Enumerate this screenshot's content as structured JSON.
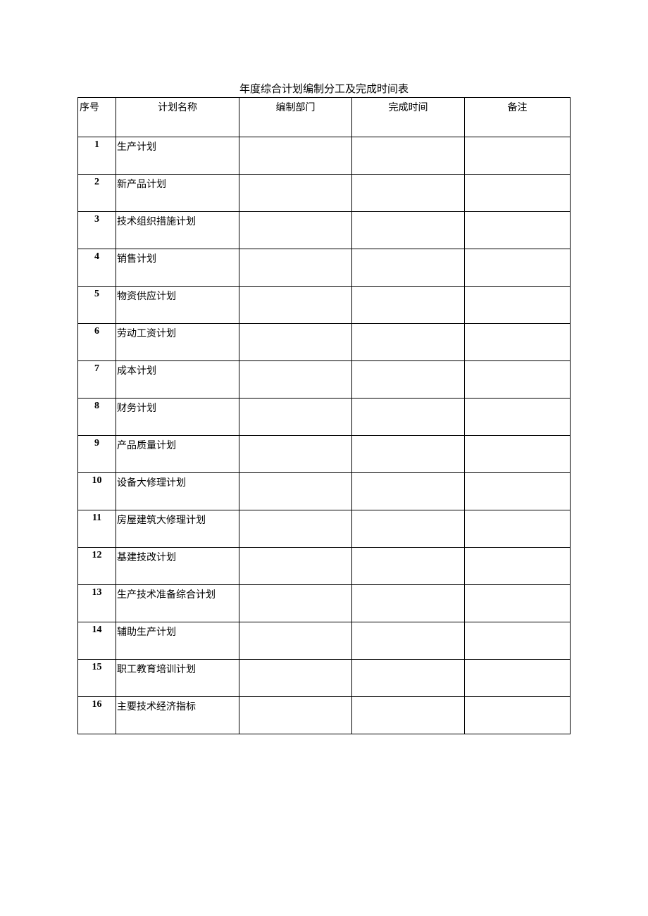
{
  "title": "年度综合计划编制分工及完成时间表",
  "headers": {
    "seq": "序号",
    "name": "计划名称",
    "dept": "编制部门",
    "time": "完成时间",
    "note": "备注"
  },
  "rows": [
    {
      "seq": "1",
      "name": "生产计划",
      "dept": "",
      "time": "",
      "note": ""
    },
    {
      "seq": "2",
      "name": "新产品计划",
      "dept": "",
      "time": "",
      "note": ""
    },
    {
      "seq": "3",
      "name": "技术组织措施计划",
      "dept": "",
      "time": "",
      "note": ""
    },
    {
      "seq": "4",
      "name": "销售计划",
      "dept": "",
      "time": "",
      "note": ""
    },
    {
      "seq": "5",
      "name": "物资供应计划",
      "dept": "",
      "time": "",
      "note": ""
    },
    {
      "seq": "6",
      "name": "劳动工资计划",
      "dept": "",
      "time": "",
      "note": ""
    },
    {
      "seq": "7",
      "name": "成本计划",
      "dept": "",
      "time": "",
      "note": ""
    },
    {
      "seq": "8",
      "name": "财务计划",
      "dept": "",
      "time": "",
      "note": ""
    },
    {
      "seq": "9",
      "name": "产品质量计划",
      "dept": "",
      "time": "",
      "note": ""
    },
    {
      "seq": "10",
      "name": "设备大修理计划",
      "dept": "",
      "time": "",
      "note": ""
    },
    {
      "seq": "11",
      "name": "房屋建筑大修理计划",
      "dept": "",
      "time": "",
      "note": ""
    },
    {
      "seq": "12",
      "name": "基建技改计划",
      "dept": "",
      "time": "",
      "note": ""
    },
    {
      "seq": "13",
      "name": "生产技术准备综合计划",
      "dept": "",
      "time": "",
      "note": ""
    },
    {
      "seq": "14",
      "name": "辅助生产计划",
      "dept": "",
      "time": "",
      "note": ""
    },
    {
      "seq": "15",
      "name": "职工教育培训计划",
      "dept": "",
      "time": "",
      "note": ""
    },
    {
      "seq": "16",
      "name": "主要技术经济指标",
      "dept": "",
      "time": "",
      "note": ""
    }
  ]
}
